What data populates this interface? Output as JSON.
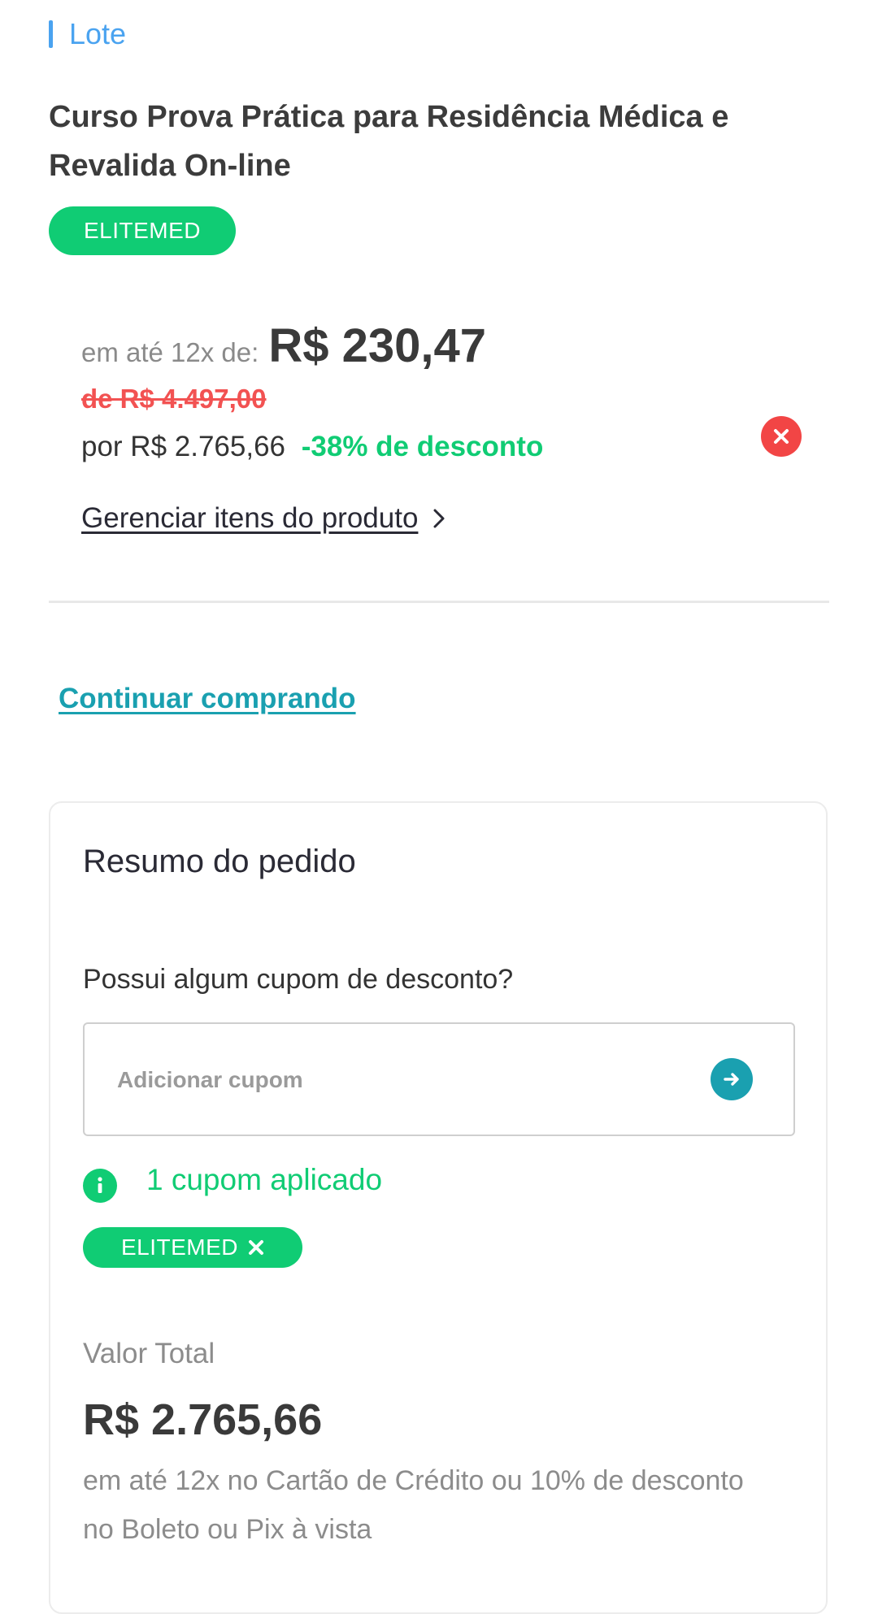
{
  "lote": {
    "label": "Lote",
    "accent": "#4aa3f0"
  },
  "product": {
    "title": "Curso Prova Prática para Residência Médica e Revalida On-line",
    "brand": "ELITEMED",
    "installment_prefix": "em até 12x de:",
    "installment_value": "R$ 230,47",
    "old_price": "de R$ 4.497,00",
    "new_price": "por R$ 2.765,66",
    "discount": "-38% de desconto",
    "manage_link": "Gerenciar itens do produto",
    "remove_icon": "close-icon",
    "manage_icon": "chevron-right-icon"
  },
  "continue_link": "Continuar comprando",
  "summary": {
    "title": "Resumo do pedido",
    "coupon_question": "Possui algum cupom de desconto?",
    "coupon_placeholder": "Adicionar cupom",
    "coupon_value": "",
    "submit_icon": "arrow-right-icon",
    "applied_text": "1 cupom aplicado",
    "info_icon": "info-icon",
    "applied_coupon": "ELITEMED",
    "total_label": "Valor Total",
    "total_value": "R$ 2.765,66",
    "payment_note": "em até 12x no Cartão de Crédito ou 10% de desconto no Boleto ou Pix à vista"
  },
  "colors": {
    "green": "#10cc74",
    "teal": "#1aa0b0",
    "red": "#f25252",
    "blue": "#4aa3f0"
  }
}
